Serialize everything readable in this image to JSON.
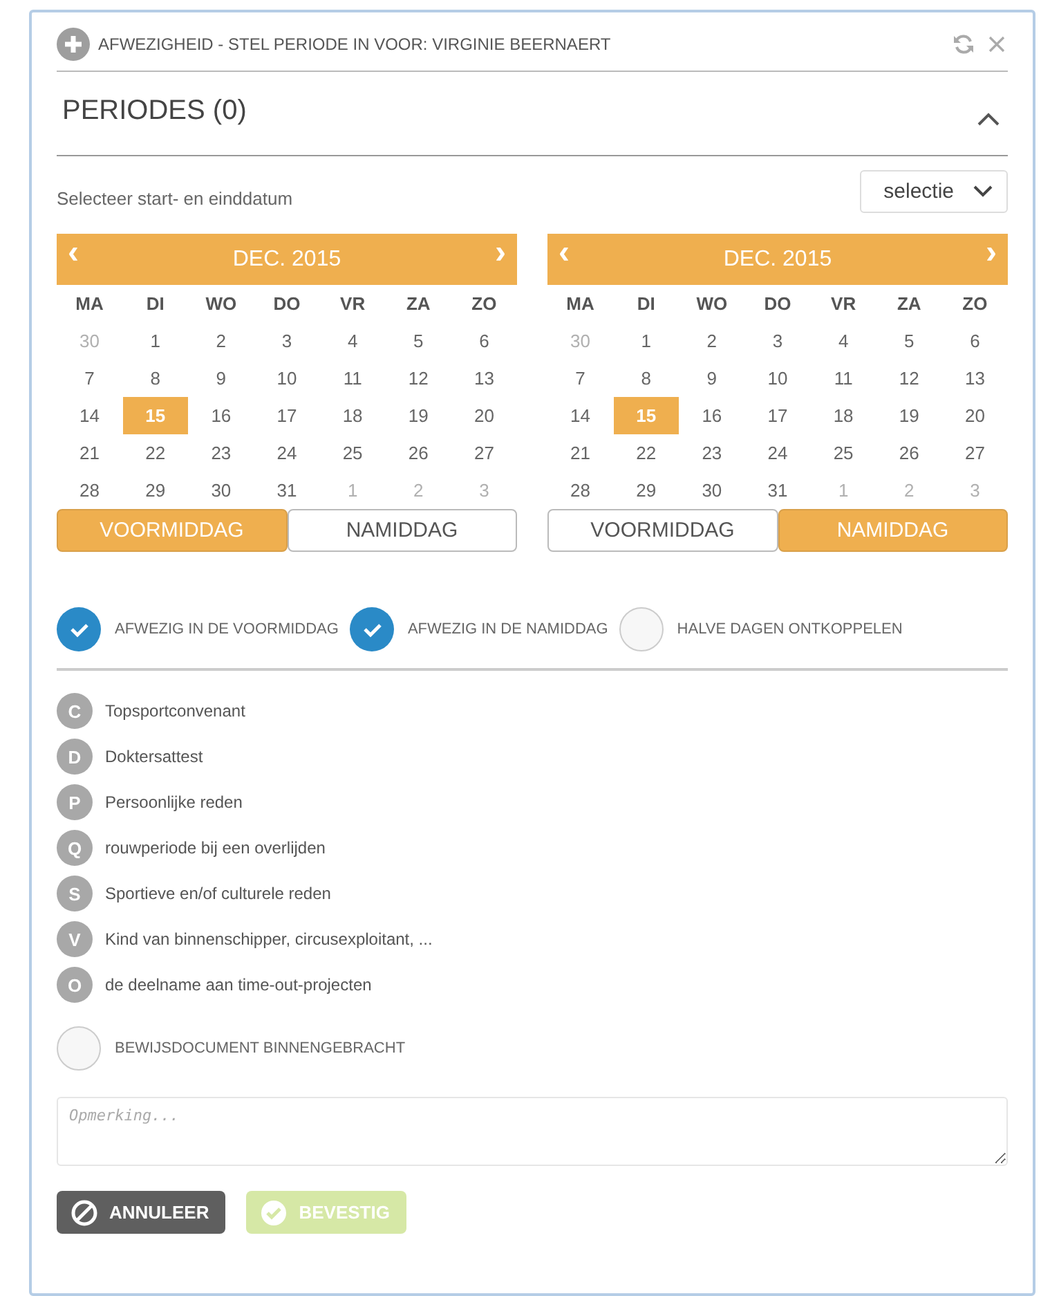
{
  "window": {
    "title": "AFWEZIGHEID - STEL PERIODE IN VOOR: VIRGINIE BEERNAERT"
  },
  "section": {
    "title": "PERIODES (0)",
    "expanded": true
  },
  "range": {
    "label": "Selecteer start- en einddatum",
    "select": "selectie"
  },
  "calendars": [
    {
      "month": "DEC. 2015",
      "prev": "‹",
      "next": "›",
      "weekdays": [
        "MA",
        "DI",
        "WO",
        "DO",
        "VR",
        "ZA",
        "ZO"
      ],
      "days": [
        {
          "t": "30",
          "muted": true,
          "selected": false
        },
        {
          "t": "1",
          "muted": false,
          "selected": false
        },
        {
          "t": "2",
          "muted": false,
          "selected": false
        },
        {
          "t": "3",
          "muted": false,
          "selected": false
        },
        {
          "t": "4",
          "muted": false,
          "selected": false
        },
        {
          "t": "5",
          "muted": false,
          "selected": false
        },
        {
          "t": "6",
          "muted": false,
          "selected": false
        },
        {
          "t": "7",
          "muted": false,
          "selected": false
        },
        {
          "t": "8",
          "muted": false,
          "selected": false
        },
        {
          "t": "9",
          "muted": false,
          "selected": false
        },
        {
          "t": "10",
          "muted": false,
          "selected": false
        },
        {
          "t": "11",
          "muted": false,
          "selected": false
        },
        {
          "t": "12",
          "muted": false,
          "selected": false
        },
        {
          "t": "13",
          "muted": false,
          "selected": false
        },
        {
          "t": "14",
          "muted": false,
          "selected": false
        },
        {
          "t": "15",
          "muted": false,
          "selected": true
        },
        {
          "t": "16",
          "muted": false,
          "selected": false
        },
        {
          "t": "17",
          "muted": false,
          "selected": false
        },
        {
          "t": "18",
          "muted": false,
          "selected": false
        },
        {
          "t": "19",
          "muted": false,
          "selected": false
        },
        {
          "t": "20",
          "muted": false,
          "selected": false
        },
        {
          "t": "21",
          "muted": false,
          "selected": false
        },
        {
          "t": "22",
          "muted": false,
          "selected": false
        },
        {
          "t": "23",
          "muted": false,
          "selected": false
        },
        {
          "t": "24",
          "muted": false,
          "selected": false
        },
        {
          "t": "25",
          "muted": false,
          "selected": false
        },
        {
          "t": "26",
          "muted": false,
          "selected": false
        },
        {
          "t": "27",
          "muted": false,
          "selected": false
        },
        {
          "t": "28",
          "muted": false,
          "selected": false
        },
        {
          "t": "29",
          "muted": false,
          "selected": false
        },
        {
          "t": "30",
          "muted": false,
          "selected": false
        },
        {
          "t": "31",
          "muted": false,
          "selected": false
        },
        {
          "t": "1",
          "muted": true,
          "selected": false
        },
        {
          "t": "2",
          "muted": true,
          "selected": false
        },
        {
          "t": "3",
          "muted": true,
          "selected": false
        }
      ],
      "halves": [
        {
          "label": "VOORMIDDAG",
          "selected": true
        },
        {
          "label": "NAMIDDAG",
          "selected": false
        }
      ]
    },
    {
      "month": "DEC. 2015",
      "prev": "‹",
      "next": "›",
      "weekdays": [
        "MA",
        "DI",
        "WO",
        "DO",
        "VR",
        "ZA",
        "ZO"
      ],
      "days": [
        {
          "t": "30",
          "muted": true,
          "selected": false
        },
        {
          "t": "1",
          "muted": false,
          "selected": false
        },
        {
          "t": "2",
          "muted": false,
          "selected": false
        },
        {
          "t": "3",
          "muted": false,
          "selected": false
        },
        {
          "t": "4",
          "muted": false,
          "selected": false
        },
        {
          "t": "5",
          "muted": false,
          "selected": false
        },
        {
          "t": "6",
          "muted": false,
          "selected": false
        },
        {
          "t": "7",
          "muted": false,
          "selected": false
        },
        {
          "t": "8",
          "muted": false,
          "selected": false
        },
        {
          "t": "9",
          "muted": false,
          "selected": false
        },
        {
          "t": "10",
          "muted": false,
          "selected": false
        },
        {
          "t": "11",
          "muted": false,
          "selected": false
        },
        {
          "t": "12",
          "muted": false,
          "selected": false
        },
        {
          "t": "13",
          "muted": false,
          "selected": false
        },
        {
          "t": "14",
          "muted": false,
          "selected": false
        },
        {
          "t": "15",
          "muted": false,
          "selected": true
        },
        {
          "t": "16",
          "muted": false,
          "selected": false
        },
        {
          "t": "17",
          "muted": false,
          "selected": false
        },
        {
          "t": "18",
          "muted": false,
          "selected": false
        },
        {
          "t": "19",
          "muted": false,
          "selected": false
        },
        {
          "t": "20",
          "muted": false,
          "selected": false
        },
        {
          "t": "21",
          "muted": false,
          "selected": false
        },
        {
          "t": "22",
          "muted": false,
          "selected": false
        },
        {
          "t": "23",
          "muted": false,
          "selected": false
        },
        {
          "t": "24",
          "muted": false,
          "selected": false
        },
        {
          "t": "25",
          "muted": false,
          "selected": false
        },
        {
          "t": "26",
          "muted": false,
          "selected": false
        },
        {
          "t": "27",
          "muted": false,
          "selected": false
        },
        {
          "t": "28",
          "muted": false,
          "selected": false
        },
        {
          "t": "29",
          "muted": false,
          "selected": false
        },
        {
          "t": "30",
          "muted": false,
          "selected": false
        },
        {
          "t": "31",
          "muted": false,
          "selected": false
        },
        {
          "t": "1",
          "muted": true,
          "selected": false
        },
        {
          "t": "2",
          "muted": true,
          "selected": false
        },
        {
          "t": "3",
          "muted": true,
          "selected": false
        }
      ],
      "halves": [
        {
          "label": "VOORMIDDAG",
          "selected": false
        },
        {
          "label": "NAMIDDAG",
          "selected": true
        }
      ]
    }
  ],
  "options": [
    {
      "label": "AFWEZIG IN DE VOORMIDDAG",
      "checked": true
    },
    {
      "label": "AFWEZIG IN DE NAMIDDAG",
      "checked": true
    },
    {
      "label": "HALVE DAGEN ONTKOPPELEN",
      "checked": false
    }
  ],
  "reasons": [
    {
      "code": "C",
      "label": "Topsportconvenant"
    },
    {
      "code": "D",
      "label": "Doktersattest"
    },
    {
      "code": "P",
      "label": "Persoonlijke reden"
    },
    {
      "code": "Q",
      "label": "rouwperiode bij een overlijden"
    },
    {
      "code": "S",
      "label": "Sportieve en/of culturele reden"
    },
    {
      "code": "V",
      "label": "Kind van binnenschipper, circusexploitant, ..."
    },
    {
      "code": "O",
      "label": "de deelname aan time-out-projecten"
    }
  ],
  "proof": {
    "label": "BEWIJSDOCUMENT BINNENGEBRACHT",
    "checked": false
  },
  "remark": {
    "placeholder": "Opmerking..."
  },
  "buttons": [
    {
      "label": "ANNULEER",
      "kind": "cancel",
      "disabled": false
    },
    {
      "label": "BEVESTIG",
      "kind": "confirm",
      "disabled": true
    }
  ]
}
